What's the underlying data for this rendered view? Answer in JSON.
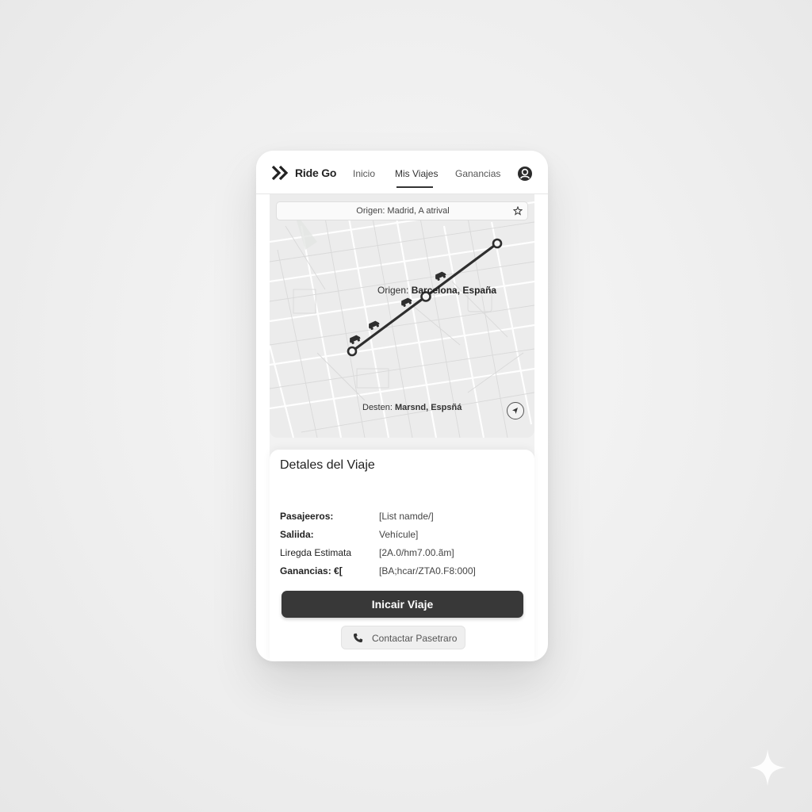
{
  "app": {
    "brand": "Ride Go",
    "accent_color": "#383838"
  },
  "nav": {
    "items": [
      {
        "label": "Inicio"
      },
      {
        "label": "Mis Viajes",
        "active": true
      },
      {
        "label": "Ganancias"
      }
    ]
  },
  "map": {
    "search_text": "Origen: Madrid, A atrival",
    "origin_prefix": "Origen:",
    "origin_place": "Barcelona, España",
    "destination_prefix": "Desten:",
    "destination_place": "Marsnd, Espsñá",
    "icons": [
      "star-icon",
      "car-icon",
      "compass-icon"
    ]
  },
  "details": {
    "title": "Detales del Viaje",
    "rows": [
      {
        "key": "Pasajeeros:",
        "value": "[List namde/]"
      },
      {
        "key": "Saliida:",
        "value": "Vehícule]"
      },
      {
        "key": "Liregda Estimata",
        "value": "[2A.0/hm7.00.ãm]"
      },
      {
        "key": "Ganancias: €[",
        "value": "[BA;hcar/ZTA0.F8:000]"
      }
    ],
    "primary_button": "Inicair Viaje",
    "secondary_button": "Contactar Pasetraro"
  }
}
